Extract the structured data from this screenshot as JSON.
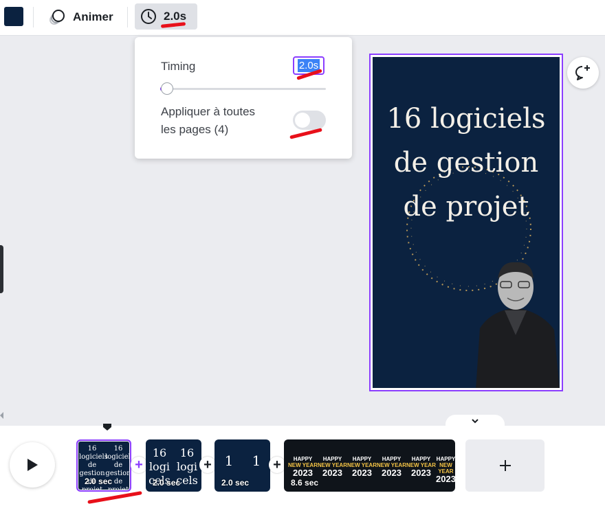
{
  "toolbar": {
    "color_swatch": "#0b2240",
    "animate_label": "Animer",
    "timing_label": "2.0s"
  },
  "timing_popover": {
    "timing_label": "Timing",
    "timing_value": "2.0s",
    "slider_value_seconds": 2.0,
    "apply_all_label": "Appliquer à toutes\nles pages (4)",
    "apply_all_enabled": false
  },
  "canvas": {
    "title": "16 logiciels\nde gestion\nde projet",
    "background": "#0b2240",
    "selection_color": "#8b3dff"
  },
  "comment_button": {
    "icon": "add-comment-icon"
  },
  "timeline": {
    "pages": [
      {
        "duration": "2.0 sec",
        "mini_text": "16 logiciels\nde gestion\nde projet",
        "selected": true
      },
      {
        "duration": "2.0 sec",
        "mini_text": "16\nlogi\ncels",
        "selected": false
      },
      {
        "duration": "2.0 sec",
        "mini_text": "1",
        "selected": false
      },
      {
        "duration": "8.6 sec",
        "mini_text": "HAPPY\nNEW YEAR\n2023",
        "selected": false
      }
    ],
    "happy_words": {
      "happy": "HAPPY",
      "new_year": "NEW YEAR",
      "year": "2023"
    }
  }
}
